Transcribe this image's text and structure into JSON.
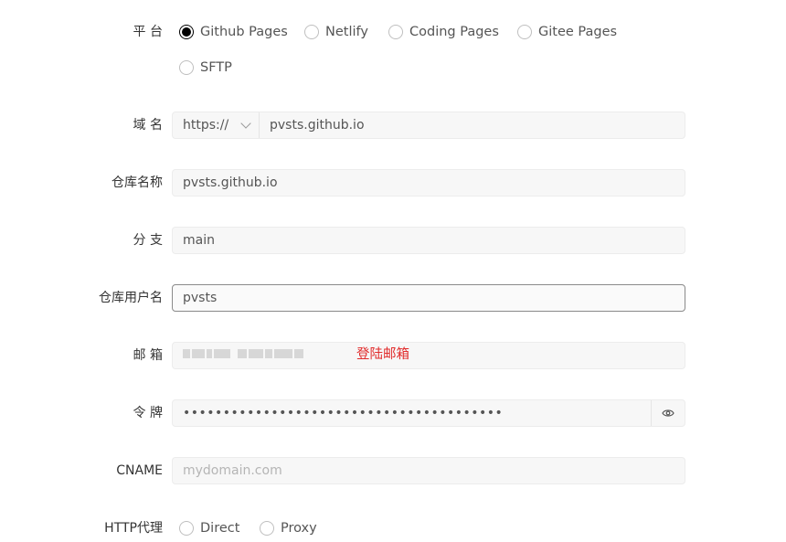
{
  "platform": {
    "label": "平 台",
    "options": [
      "Github Pages",
      "Netlify",
      "Coding Pages",
      "Gitee Pages",
      "SFTP"
    ],
    "selected": "Github Pages"
  },
  "domain": {
    "label": "域 名",
    "protocol": "https://",
    "value": "pvsts.github.io"
  },
  "repo_name": {
    "label": "仓库名称",
    "value": "pvsts.github.io"
  },
  "branch": {
    "label": "分 支",
    "value": "main"
  },
  "repo_user": {
    "label": "仓库用户名",
    "value": "pvsts"
  },
  "email": {
    "label": "邮 箱",
    "annotation": "登陆邮箱"
  },
  "token": {
    "label": "令 牌",
    "value": "••••••••••••••••••••••••••••••••••••••••"
  },
  "cname": {
    "label": "CNAME",
    "placeholder": "mydomain.com"
  },
  "proxy": {
    "label": "HTTP代理",
    "options": [
      "Direct",
      "Proxy"
    ]
  },
  "icons": {
    "reveal": "eye-icon",
    "protocol_dropdown": "chevron-down-icon"
  }
}
